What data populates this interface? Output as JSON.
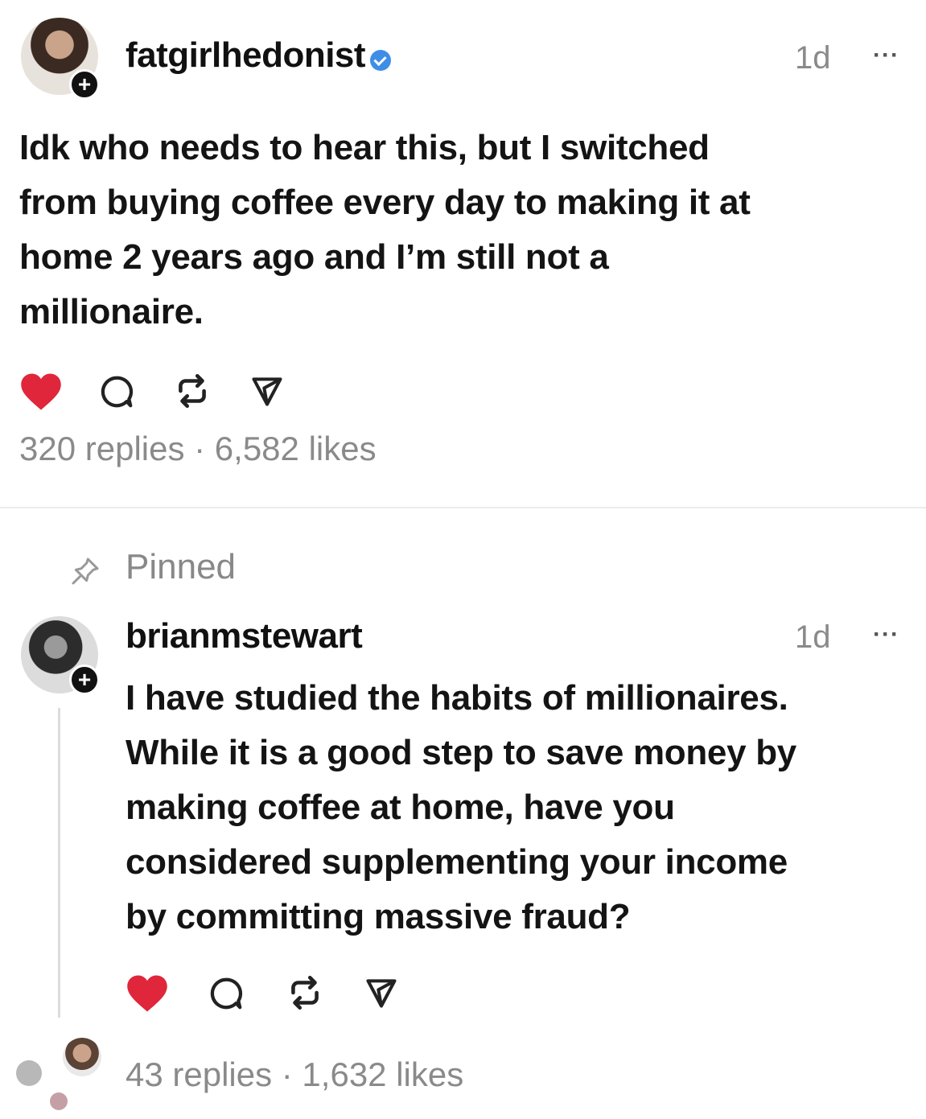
{
  "post": {
    "username": "fatgirlhedonist",
    "verified": true,
    "time": "1d",
    "more": "···",
    "text_lines": [
      "Idk who needs to hear this, but I switched",
      "from buying coffee every day to making it at",
      "home 2 years ago and I’m still not a",
      "millionaire."
    ],
    "liked": true,
    "stats": "320 replies · 6,582 likes"
  },
  "pinned_label": "Pinned",
  "reply": {
    "username": "brianmstewart",
    "time": "1d",
    "more": "···",
    "text_lines": [
      "I have studied the habits of millionaires.",
      "While it is a good step to save money by",
      "making coffee at home, have you",
      "considered supplementing your income",
      "by committing massive fraud?"
    ],
    "liked": true,
    "stats": "43 replies · 1,632 likes"
  },
  "colors": {
    "like_red": "#e0263a",
    "verified_blue": "#3e8ee8",
    "muted_gray": "#8a8a8a"
  },
  "icons": [
    "heart-icon",
    "comment-icon",
    "repost-icon",
    "share-icon",
    "pin-icon",
    "plus-icon",
    "verified-icon",
    "more-icon"
  ]
}
